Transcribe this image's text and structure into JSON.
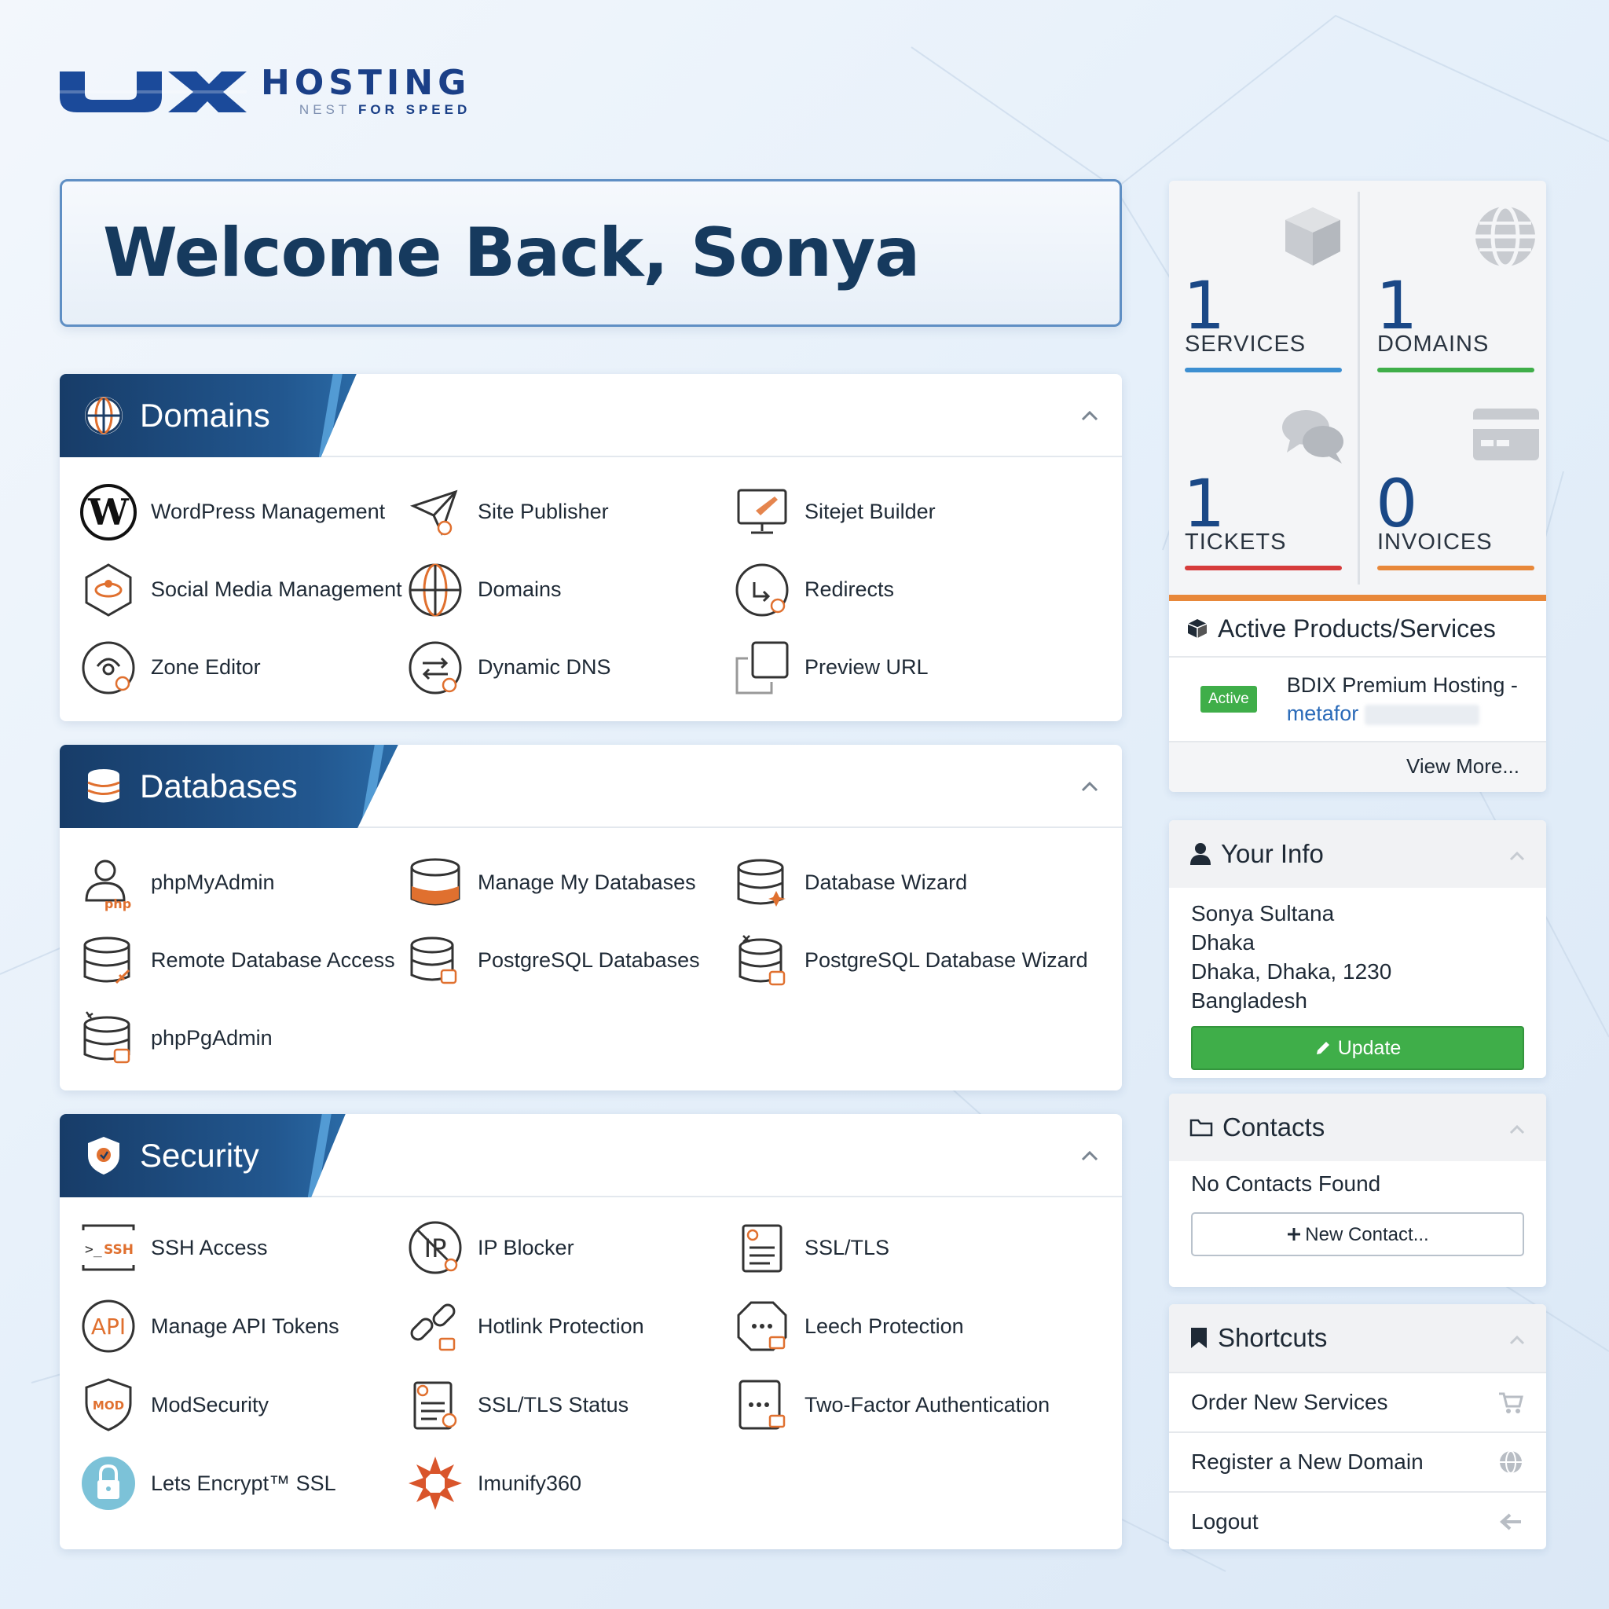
{
  "brand": {
    "hosting": "HOSTING",
    "tag_nest": "NEST",
    "tag_speed": "FOR SPEED"
  },
  "welcome": {
    "title": "Welcome Back, Sonya"
  },
  "panels": {
    "domains": {
      "title": "Domains",
      "items": [
        "WordPress Management",
        "Site Publisher",
        "Sitejet Builder",
        "Social Media Management",
        "Domains",
        "Redirects",
        "Zone Editor",
        "Dynamic DNS",
        "Preview URL"
      ]
    },
    "databases": {
      "title": "Databases",
      "items": [
        "phpMyAdmin",
        "Manage My Databases",
        "Database Wizard",
        "Remote Database Access",
        "PostgreSQL Databases",
        "PostgreSQL Database Wizard",
        "phpPgAdmin"
      ]
    },
    "security": {
      "title": "Security",
      "items": [
        "SSH Access",
        "IP Blocker",
        "SSL/TLS",
        "Manage API Tokens",
        "Hotlink Protection",
        "Leech Protection",
        "ModSecurity",
        "SSL/TLS Status",
        "Two-Factor Authentication",
        "Lets Encrypt™ SSL",
        "Imunify360"
      ]
    }
  },
  "stats": [
    {
      "value": "1",
      "label": "SERVICES",
      "color": "#3d8fd1",
      "icon": "box-icon"
    },
    {
      "value": "1",
      "label": "DOMAINS",
      "color": "#3fae49",
      "icon": "globe-icon"
    },
    {
      "value": "1",
      "label": "TICKETS",
      "color": "#d63c3c",
      "icon": "chat-icon"
    },
    {
      "value": "0",
      "label": "INVOICES",
      "color": "#e8883a",
      "icon": "credit-card-icon"
    }
  ],
  "active_products": {
    "title": "Active Products/Services",
    "badge": "Active",
    "product": "BDIX Premium Hosting -",
    "domain": "metafor",
    "view_more": "View More..."
  },
  "your_info": {
    "title": "Your Info",
    "name": "Sonya Sultana",
    "city": "Dhaka",
    "region": "Dhaka, Dhaka, 1230",
    "country": "Bangladesh",
    "update_label": "Update"
  },
  "contacts": {
    "title": "Contacts",
    "empty": "No Contacts Found",
    "new_label": "New Contact..."
  },
  "shortcuts": {
    "title": "Shortcuts",
    "items": [
      {
        "label": "Order New Services",
        "icon": "cart-icon"
      },
      {
        "label": "Register a New Domain",
        "icon": "globe-icon"
      },
      {
        "label": "Logout",
        "icon": "arrow-left-icon"
      }
    ]
  },
  "colors": {
    "navy": "#173c68",
    "accent_orange": "#e8883a",
    "green": "#3fae49"
  }
}
